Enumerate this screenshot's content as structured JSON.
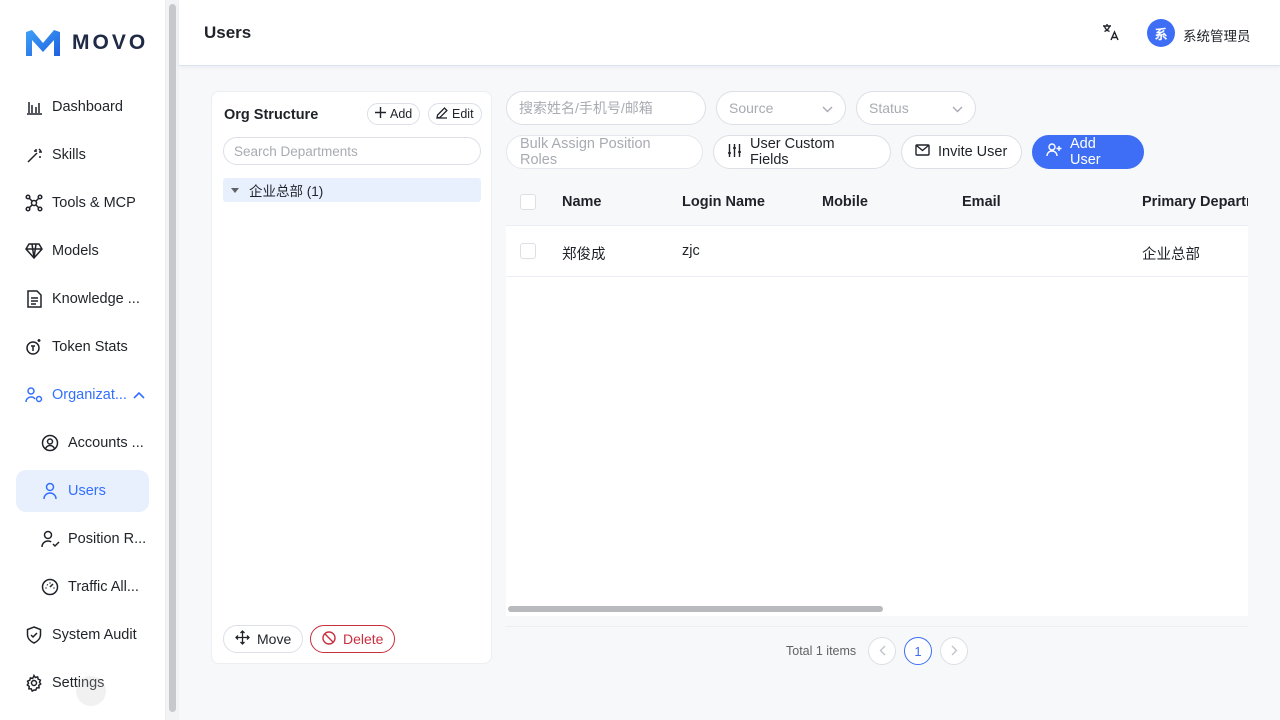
{
  "app": {
    "logo_text": "MOVO"
  },
  "sidebar": {
    "items": [
      {
        "label": "Dashboard",
        "icon": "bar-chart-icon"
      },
      {
        "label": "Skills",
        "icon": "magic-wand-icon"
      },
      {
        "label": "Tools & MCP",
        "icon": "network-icon"
      },
      {
        "label": "Models",
        "icon": "diamond-icon"
      },
      {
        "label": "Knowledge ...",
        "icon": "document-icon"
      },
      {
        "label": "Token Stats",
        "icon": "token-icon"
      },
      {
        "label": "Organizat...",
        "icon": "org-icon"
      },
      {
        "label": "Accounts ...",
        "icon": "user-circle-icon"
      },
      {
        "label": "Users",
        "icon": "user-icon"
      },
      {
        "label": "Position R...",
        "icon": "user-check-icon"
      },
      {
        "label": "Traffic All...",
        "icon": "gauge-icon"
      },
      {
        "label": "System Audit",
        "icon": "shield-icon"
      },
      {
        "label": "Settings",
        "icon": "gear-icon"
      }
    ]
  },
  "header": {
    "title": "Users",
    "avatar_letter": "系",
    "user_name": "系统管理员"
  },
  "org": {
    "title": "Org Structure",
    "add_label": "Add",
    "edit_label": "Edit",
    "search_placeholder": "Search Departments",
    "tree_root": "企业总部 (1)",
    "move_label": "Move",
    "delete_label": "Delete"
  },
  "filters": {
    "search_placeholder": "搜索姓名/手机号/邮箱",
    "source_placeholder": "Source",
    "status_placeholder": "Status"
  },
  "toolbar": {
    "bulk_assign": "Bulk Assign Position Roles",
    "custom_fields": "User Custom Fields",
    "invite_user": "Invite User",
    "add_user": "Add User"
  },
  "table": {
    "columns": [
      "Name",
      "Login Name",
      "Mobile",
      "Email",
      "Primary Departm"
    ],
    "rows": [
      {
        "name": "郑俊成",
        "login": "zjc",
        "mobile": "",
        "email": "",
        "dept": "企业总部"
      }
    ]
  },
  "pagination": {
    "total_text": "Total 1 items",
    "current_page": "1"
  },
  "colors": {
    "accent": "#3d6ef5",
    "danger": "#c9303e",
    "active_bg": "#e8f0fe"
  }
}
